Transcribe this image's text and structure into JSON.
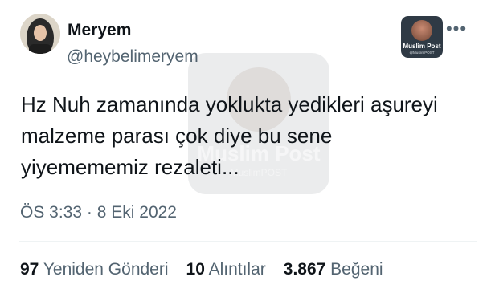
{
  "user": {
    "display_name": "Meryem",
    "handle": "@heybelimeryem"
  },
  "tweet": {
    "lines": [
      "Hz Nuh zamanında yoklukta yedikleri aşureyi",
      "malzeme parası çok diye bu sene",
      "yiyemememiz rezaleti..."
    ],
    "time": "ÖS 3:33",
    "separator": "·",
    "date": "8 Eki 2022"
  },
  "stats": {
    "retweets_count": "97",
    "retweets_label": "Yeniden Gönderi",
    "quotes_count": "10",
    "quotes_label": "Alıntılar",
    "likes_count": "3.867",
    "likes_label": "Beğeni"
  },
  "badge": {
    "title": "Muslim Post",
    "subtitle": "@MuslimPOST"
  },
  "watermark": {
    "title": "Muslim Post",
    "subtitle": "MuslimPOST"
  },
  "icons": {
    "more": "more-options-icon"
  },
  "colors": {
    "text_primary": "#0f1419",
    "text_secondary": "#536471",
    "divider": "#eff3f4"
  }
}
